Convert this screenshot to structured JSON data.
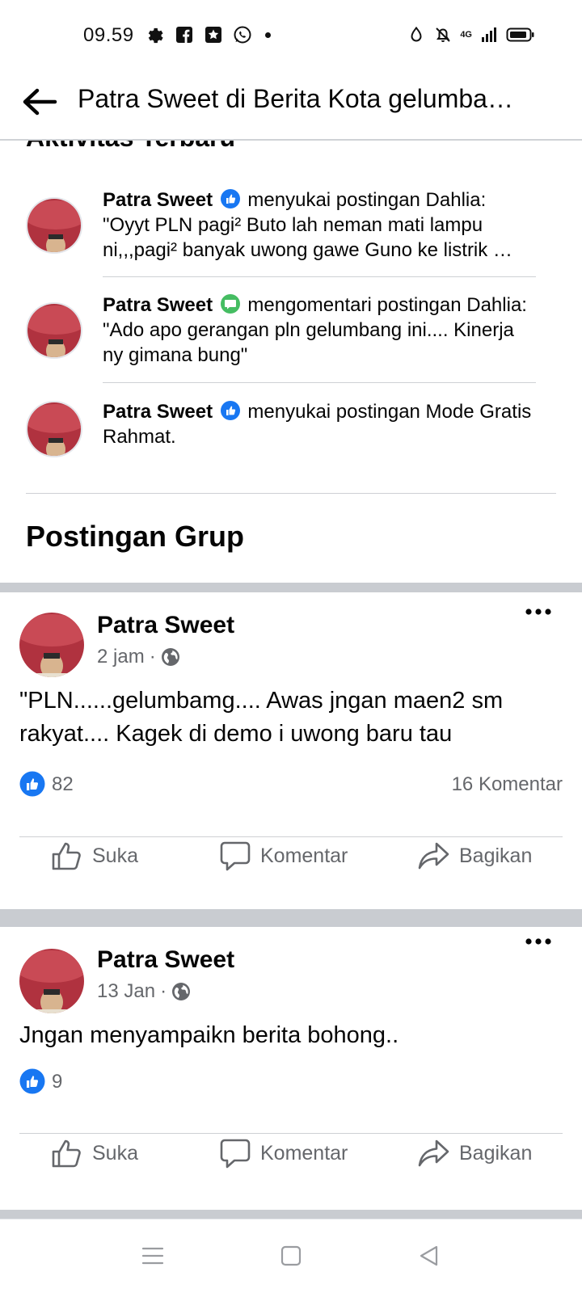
{
  "status_bar": {
    "time": "09.59",
    "network": "4G",
    "left_icons": [
      "gear-icon",
      "facebook-icon",
      "star-app-icon",
      "whatsapp-icon",
      "dot-icon"
    ],
    "right_icons": [
      "data-saver-icon",
      "mute-bell-icon",
      "signal-icon",
      "battery-icon"
    ]
  },
  "header": {
    "title": "Patra Sweet di Berita Kota gelumba…"
  },
  "activity_section": {
    "cut_heading": "Aktivitas Terbaru",
    "items": [
      {
        "actor": "Patra Sweet",
        "badge": "like-badge-icon",
        "text": "menyukai postingan Dahlia: \"Oyyt PLN pagi² Buto lah neman mati lampu ni,,,pagi² banyak uwong gawe Guno ke listrik …"
      },
      {
        "actor": "Patra Sweet",
        "badge": "comment-badge-icon",
        "text": "mengomentari postingan Dahlia: \"Ado apo gerangan pln gelumbang ini.... Kinerja ny gimana bung\""
      },
      {
        "actor": "Patra Sweet",
        "badge": "like-badge-icon",
        "text": "menyukai postingan Mode Gratis Rahmat."
      }
    ]
  },
  "group_posts": {
    "title": "Postingan Grup",
    "posts": [
      {
        "author": "Patra Sweet",
        "time": "2 jam",
        "separator": "·",
        "text": "\"PLN......gelumbamg.... Awas jngan maen2 sm rakyat.... Kagek di demo i uwong baru tau",
        "likes": "82",
        "comments": "16 Komentar"
      },
      {
        "author": "Patra Sweet",
        "time": "13 Jan",
        "separator": "·",
        "text": "Jngan menyampaikn berita bohong..",
        "likes": "9",
        "comments": ""
      }
    ],
    "actions": {
      "like": "Suka",
      "comment": "Komentar",
      "share": "Bagikan"
    }
  },
  "colors": {
    "facebook_blue": "#1877f2",
    "comment_green": "#45bd62",
    "secondary_text": "#65676b",
    "divider": "#ced0d4",
    "feed_separator": "#c9ccd1"
  }
}
